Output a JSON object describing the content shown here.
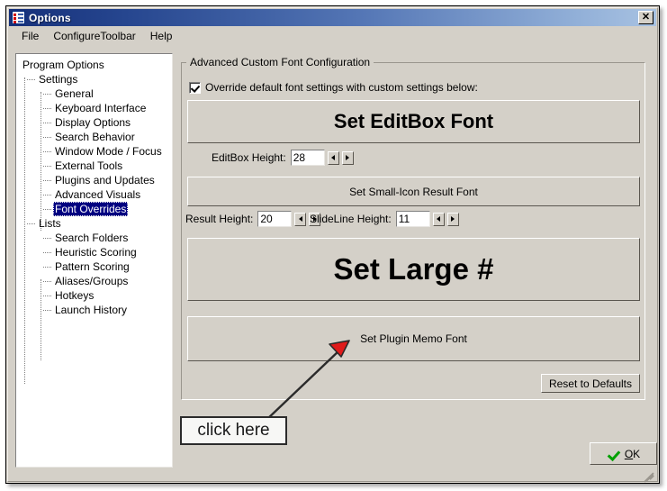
{
  "window": {
    "title": "Options",
    "icon": "options-list-icon",
    "close_label": "✕"
  },
  "menu": {
    "items": [
      {
        "label": "File"
      },
      {
        "label": "ConfigureToolbar"
      },
      {
        "label": "Help"
      }
    ]
  },
  "tree": {
    "nodes": [
      {
        "label": "Program Options",
        "depth": 0,
        "selected": false
      },
      {
        "label": "Settings",
        "depth": 1,
        "selected": false
      },
      {
        "label": "General",
        "depth": 2,
        "selected": false
      },
      {
        "label": "Keyboard Interface",
        "depth": 2,
        "selected": false
      },
      {
        "label": "Display Options",
        "depth": 2,
        "selected": false
      },
      {
        "label": "Search Behavior",
        "depth": 2,
        "selected": false
      },
      {
        "label": "Window Mode / Focus",
        "depth": 2,
        "selected": false
      },
      {
        "label": "External Tools",
        "depth": 2,
        "selected": false
      },
      {
        "label": "Plugins and Updates",
        "depth": 2,
        "selected": false
      },
      {
        "label": "Advanced Visuals",
        "depth": 2,
        "selected": false
      },
      {
        "label": "Font Overrides",
        "depth": 2,
        "selected": true
      },
      {
        "label": "Lists",
        "depth": 1,
        "selected": false
      },
      {
        "label": "Search Folders",
        "depth": 2,
        "selected": false
      },
      {
        "label": "Heuristic Scoring",
        "depth": 2,
        "selected": false
      },
      {
        "label": "Pattern Scoring",
        "depth": 2,
        "selected": false
      },
      {
        "label": "Aliases/Groups",
        "depth": 2,
        "selected": false
      },
      {
        "label": "Hotkeys",
        "depth": 2,
        "selected": false
      },
      {
        "label": "Launch History",
        "depth": 2,
        "selected": false
      }
    ]
  },
  "groupbox": {
    "title": "Advanced Custom Font Configuration",
    "override": {
      "label": "Override default font settings with custom settings below:",
      "checked": true
    },
    "buttons": {
      "editbox_font": "Set EditBox Font",
      "small_icon_result_font": "Set Small-Icon Result Font",
      "large_number_font": "Set Large #",
      "plugin_memo_font": "Set Plugin Memo Font",
      "reset_to_defaults": "Reset to Defaults"
    },
    "fields": {
      "editbox_height": {
        "label": "EditBox Height:",
        "value": "28"
      },
      "result_height": {
        "label": "Result Height:",
        "value": "20"
      },
      "slideline_height": {
        "label": "SlideLine Height:",
        "value": "11"
      }
    },
    "spinner": {
      "dec_icon": "triangle-left-icon",
      "inc_icon": "triangle-right-icon"
    }
  },
  "footer": {
    "ok_label": "OK",
    "ok_accel": "O",
    "ok_rest": "K",
    "ok_icon": "green-check-icon"
  },
  "annotation": {
    "callout_text": "click here",
    "arrow_color": "#e01b1b",
    "arrow_line_color": "#2b2b2b"
  },
  "colors": {
    "face": "#d4d0c8",
    "title_gradient_start": "#16307a",
    "title_gradient_end": "#a8c2e2",
    "selection": "#000080",
    "ok_check": "#00a000"
  }
}
